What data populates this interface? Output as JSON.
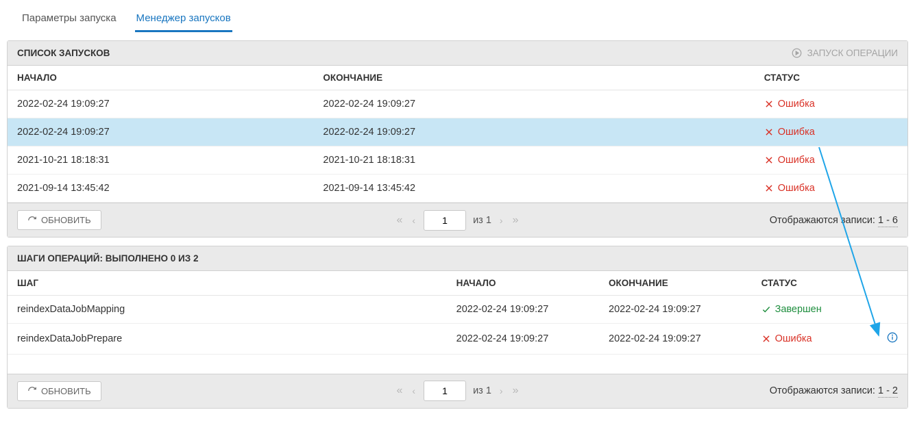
{
  "tabs": {
    "params": "Параметры запуска",
    "manager": "Менеджер запусков"
  },
  "runs_panel": {
    "title": "СПИСОК ЗАПУСКОВ",
    "run_op": "ЗАПУСК ОПЕРАЦИИ",
    "cols": {
      "start": "НАЧАЛО",
      "end": "ОКОНЧАНИЕ",
      "status": "СТАТУС"
    },
    "rows": [
      {
        "start": "2022-02-24 19:09:27",
        "end": "2022-02-24 19:09:27",
        "status_text": "Ошибка",
        "status": "error",
        "selected": false
      },
      {
        "start": "2022-02-24 19:09:27",
        "end": "2022-02-24 19:09:27",
        "status_text": "Ошибка",
        "status": "error",
        "selected": true
      },
      {
        "start": "2021-10-21 18:18:31",
        "end": "2021-10-21 18:18:31",
        "status_text": "Ошибка",
        "status": "error",
        "selected": false
      },
      {
        "start": "2021-09-14 13:45:42",
        "end": "2021-09-14 13:45:42",
        "status_text": "Ошибка",
        "status": "error",
        "selected": false
      }
    ],
    "footer": {
      "refresh": "ОБНОВИТЬ",
      "page": "1",
      "pages_of": "из 1",
      "records_label": "Отображаются записи:",
      "records_range": "1 - 6"
    }
  },
  "steps_panel": {
    "title": "ШАГИ ОПЕРАЦИЙ: ВЫПОЛНЕНО 0 ИЗ 2",
    "cols": {
      "step": "ШАГ",
      "start": "НАЧАЛО",
      "end": "ОКОНЧАНИЕ",
      "status": "СТАТУС"
    },
    "rows": [
      {
        "step": "reindexDataJobMapping",
        "start": "2022-02-24 19:09:27",
        "end": "2022-02-24 19:09:27",
        "status_text": "Завершен",
        "status": "success",
        "info": false
      },
      {
        "step": "reindexDataJobPrepare",
        "start": "2022-02-24 19:09:27",
        "end": "2022-02-24 19:09:27",
        "status_text": "Ошибка",
        "status": "error",
        "info": true
      }
    ],
    "footer": {
      "refresh": "ОБНОВИТЬ",
      "page": "1",
      "pages_of": "из 1",
      "records_label": "Отображаются записи:",
      "records_range": "1 - 2"
    }
  }
}
